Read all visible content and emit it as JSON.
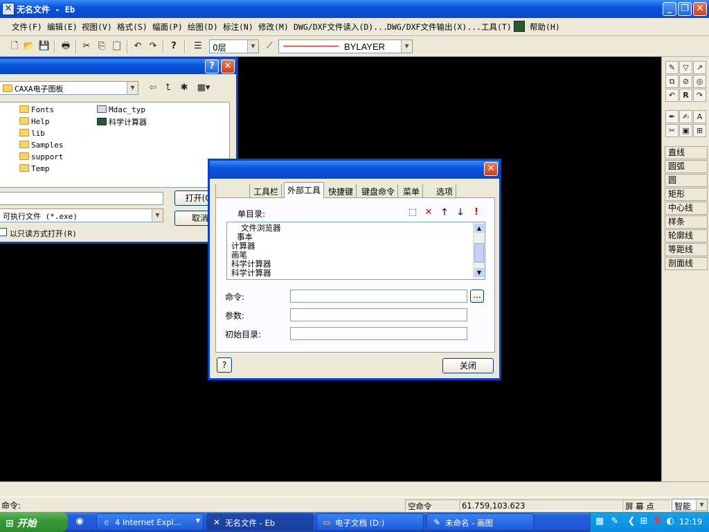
{
  "window": {
    "title": "无名文件 - Eb",
    "buttons": [
      "_",
      "❐",
      "✕"
    ]
  },
  "menu": [
    "文件(F)",
    "编辑(E)",
    "视图(V)",
    "格式(S)",
    "幅面(P)",
    "绘图(D)",
    "标注(N)",
    "修改(M)",
    "DWG/DXF文件读入(D)...",
    "DWG/DXF文件输出(X)...",
    "工具(T)",
    "帮助(H)"
  ],
  "toolbar": {
    "layer": "0层",
    "linetype": "BYLAYER"
  },
  "right_panel": {
    "commands": [
      "直线",
      "圆弧",
      "圆",
      "矩形",
      "中心线",
      "样条",
      "轮廓线",
      "等距线",
      "剖面线"
    ]
  },
  "open_dialog": {
    "look_in": "CAXA电子图板",
    "folders": [
      "Fonts",
      "Help",
      "lib",
      "Samples",
      "support",
      "Temp"
    ],
    "files": [
      "Mdac_typ",
      "科学计算器"
    ],
    "file_type": "可执行文件 (*.exe)",
    "readonly_label": "以只读方式打开(R)",
    "open_label": "打开(O)",
    "cancel_label": "取消"
  },
  "tools_dialog": {
    "tabs": [
      "工具栏",
      "外部工具",
      "快捷键",
      "键盘命令",
      "菜单",
      "选项"
    ],
    "active_tab": "外部工具",
    "list_label": "单目录:",
    "list_items": [
      "文件浏览器",
      "事本",
      "计算器",
      "画笔",
      "科学计算器",
      "科学计算器"
    ],
    "command_label": "命令:",
    "params_label": "参数:",
    "initdir_label": "初始目录:",
    "browse_label": "...",
    "close_label": "关闭"
  },
  "status": {
    "command_prompt": "命令:",
    "empty_cmd": "空命令",
    "coords": "61.759,103.623",
    "snap": "屏 幕 点",
    "snap_mode": "智能"
  },
  "taskbar": {
    "start": "开始",
    "tasks": [
      "4 Internet Expl...",
      "无名文件 - Eb",
      "电子文档 (D:)",
      "未命名 - 画图"
    ],
    "clock": "12:19"
  }
}
